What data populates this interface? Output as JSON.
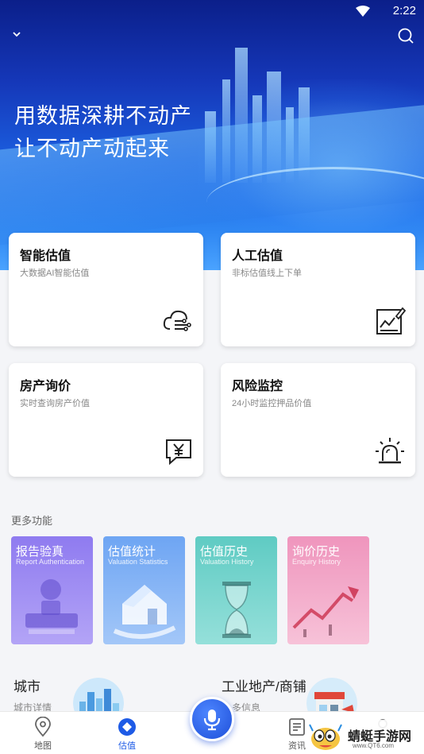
{
  "status": {
    "time": "2:22"
  },
  "hero": {
    "line1": "用数据深耕不动产",
    "line2": "让不动产动起来"
  },
  "cards": [
    {
      "title": "智能估值",
      "subtitle": "大数据AI智能估值",
      "icon": "cloud-data-icon"
    },
    {
      "title": "人工估值",
      "subtitle": "非标估值线上下单",
      "icon": "chart-edit-icon"
    },
    {
      "title": "房产询价",
      "subtitle": "实时查询房产价值",
      "icon": "yen-chat-icon"
    },
    {
      "title": "风险监控",
      "subtitle": "24小时监控押品价值",
      "icon": "alarm-light-icon"
    }
  ],
  "more": {
    "label": "更多功能",
    "tiles": [
      {
        "title": "报告验真",
        "subtitle": "Report Authentication",
        "color": "#9a86f2"
      },
      {
        "title": "估值统计",
        "subtitle": "Valuation Statistics",
        "color": "#7fb0f5"
      },
      {
        "title": "估值历史",
        "subtitle": "Valuation History",
        "color": "#6ed3cc"
      },
      {
        "title": "询价历史",
        "subtitle": "Enquiry History",
        "color": "#f2a1c4"
      }
    ]
  },
  "info": {
    "city_title": "城市",
    "city_sub": "城市详情",
    "industrial_title": "工业地产/商铺",
    "industrial_sub": "多信息"
  },
  "tabs": [
    {
      "label": "地图",
      "icon": "map-pin-icon"
    },
    {
      "label": "估值",
      "icon": "diamond-icon",
      "active": true
    },
    {
      "label": "资讯",
      "icon": "news-icon"
    }
  ],
  "watermark": {
    "text": "蜻蜓手游网",
    "url": "www.QT6.com"
  }
}
